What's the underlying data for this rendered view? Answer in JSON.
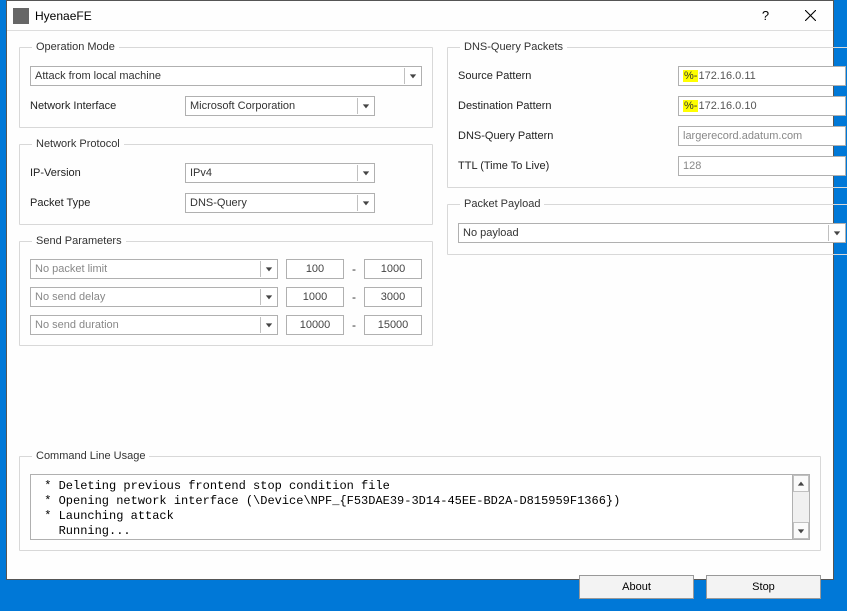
{
  "window": {
    "title": "HyenaeFE"
  },
  "groups": {
    "operation_mode": "Operation Mode",
    "network_protocol": "Network Protocol",
    "send_parameters": "Send Parameters",
    "dns_query_packets": "DNS-Query Packets",
    "packet_payload": "Packet Payload",
    "command_line_usage": "Command Line Usage"
  },
  "operation": {
    "mode_value": "Attack from local machine",
    "iface_label": "Network Interface",
    "iface_value": "Microsoft Corporation"
  },
  "protocol": {
    "ip_label": "IP-Version",
    "ip_value": "IPv4",
    "ptype_label": "Packet Type",
    "ptype_value": "DNS-Query"
  },
  "send": {
    "limit_value": "No packet limit",
    "limit_min": "100",
    "limit_max": "1000",
    "delay_value": "No send delay",
    "delay_min": "1000",
    "delay_max": "3000",
    "duration_value": "No send duration",
    "duration_min": "10000",
    "duration_max": "15000",
    "dash": "-"
  },
  "dns": {
    "src_label": "Source Pattern",
    "src_prefix": "%-",
    "src_value": "172.16.0.11",
    "dst_label": "Destination Pattern",
    "dst_prefix": "%-",
    "dst_value": "172.16.0.10",
    "query_label": "DNS-Query Pattern",
    "query_value": "largerecord.adatum.com",
    "ttl_label": "TTL (Time To Live)",
    "ttl_value": "128"
  },
  "payload": {
    "value": "No payload"
  },
  "console": {
    "text": " * Deleting previous frontend stop condition file\n * Opening network interface (\\Device\\NPF_{F53DAE39-3D14-45EE-BD2A-D815959F1366})\n * Launching attack\n   Running..."
  },
  "buttons": {
    "about": "About",
    "stop": "Stop"
  }
}
